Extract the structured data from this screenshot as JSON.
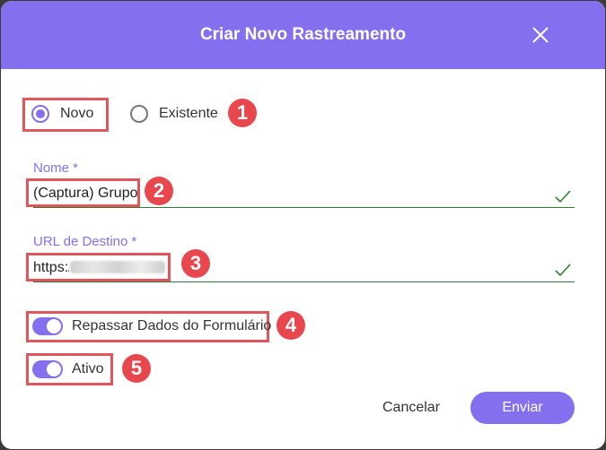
{
  "dialog": {
    "title": "Criar Novo Rastreamento"
  },
  "mode": {
    "options": [
      {
        "label": "Novo",
        "selected": true
      },
      {
        "label": "Existente",
        "selected": false
      }
    ]
  },
  "fields": {
    "name": {
      "label": "Nome *",
      "value": "(Captura) Grupo"
    },
    "url": {
      "label": "URL de Destino *",
      "value": "https:/"
    }
  },
  "toggles": {
    "pass_form": {
      "label": "Repassar Dados do Formulário",
      "on": true
    },
    "active": {
      "label": "Ativo",
      "on": true
    }
  },
  "actions": {
    "cancel": "Cancelar",
    "submit": "Enviar"
  },
  "annotations": [
    "1",
    "2",
    "3",
    "4",
    "5"
  ],
  "colors": {
    "accent": "#8470ee",
    "annotation": "#e8474e",
    "valid": "#2e7d32"
  }
}
